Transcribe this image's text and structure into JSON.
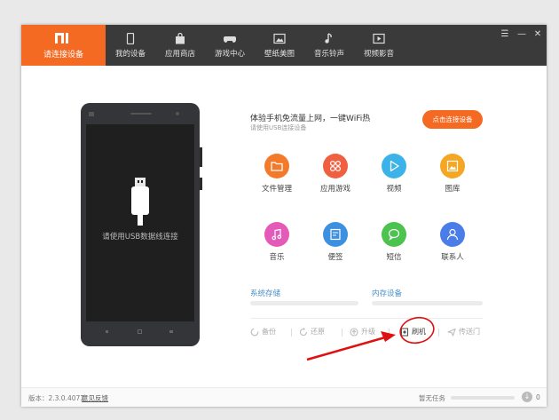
{
  "window": {
    "nav": {
      "connect_tab": "请连接设备",
      "tabs": [
        {
          "label": "我的设备",
          "icon": "phone-icon"
        },
        {
          "label": "应用商店",
          "icon": "shopping-bag-icon"
        },
        {
          "label": "游戏中心",
          "icon": "gamepad-icon"
        },
        {
          "label": "壁纸美图",
          "icon": "picture-icon"
        },
        {
          "label": "音乐铃声",
          "icon": "music-note-icon"
        },
        {
          "label": "视频影音",
          "icon": "video-icon"
        }
      ]
    },
    "controls": {
      "menu": "☰",
      "minimize": "—",
      "close": "✕"
    }
  },
  "phone": {
    "message": "请使用USB数据线连接"
  },
  "promo": {
    "title": "体验手机免流量上网，一键WiFi热",
    "subtitle": "请使用USB连接设备",
    "button": "点击连接设备"
  },
  "apps": [
    {
      "label": "文件管理",
      "icon": "folder-icon",
      "color": "#f47a2a"
    },
    {
      "label": "应用游戏",
      "icon": "apps-grid-icon",
      "color": "#f06040"
    },
    {
      "label": "视频",
      "icon": "play-icon",
      "color": "#3bb3e8"
    },
    {
      "label": "图库",
      "icon": "image-icon",
      "color": "#f5a623"
    },
    {
      "label": "音乐",
      "icon": "music-icon",
      "color": "#e45ab8"
    },
    {
      "label": "便签",
      "icon": "note-icon",
      "color": "#3d8fe0"
    },
    {
      "label": "短信",
      "icon": "message-icon",
      "color": "#4cc24f"
    },
    {
      "label": "联系人",
      "icon": "contact-icon",
      "color": "#4a7de8"
    }
  ],
  "storage": {
    "system": "系统存储",
    "internal": "内存设备"
  },
  "actions": [
    {
      "label": "备份",
      "icon": "backup-icon"
    },
    {
      "label": "还原",
      "icon": "restore-icon"
    },
    {
      "label": "升级",
      "icon": "upgrade-icon"
    },
    {
      "label": "刷机",
      "icon": "flash-icon"
    },
    {
      "label": "传送门",
      "icon": "send-icon"
    }
  ],
  "status": {
    "version": "版本：2.3.0.4071",
    "feedback": "意见反馈",
    "task": "暂无任务",
    "count": "0"
  }
}
